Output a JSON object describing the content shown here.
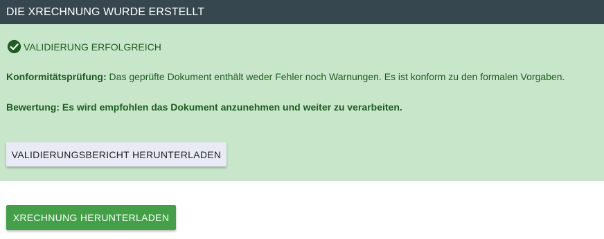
{
  "header": {
    "title": "DIE XRECHNUNG WURDE ERSTELLT"
  },
  "validation": {
    "status_icon": "check-circle-icon",
    "status_text": "VALIDIERUNG ERFOLGREICH",
    "conformity_label": "Konformitätsprüfung:",
    "conformity_text": " Das geprüfte Dokument enthält weder Fehler noch Warnungen. Es ist konform zu den formalen Vorgaben.",
    "rating_text": "Bewertung: Es wird empfohlen das Dokument anzunehmen und weiter zu verarbeiten.",
    "report_button_label": "VALIDIERUNGSBERICHT HERUNTERLADEN"
  },
  "actions": {
    "download_button_label": "XRECHNUNG HERUNTERLADEN"
  },
  "colors": {
    "header_bg": "#37474f",
    "panel_bg": "#c8e6c9",
    "success_text": "#1b5e20",
    "primary_button": "#43a047",
    "secondary_button": "#e8eaf6"
  }
}
